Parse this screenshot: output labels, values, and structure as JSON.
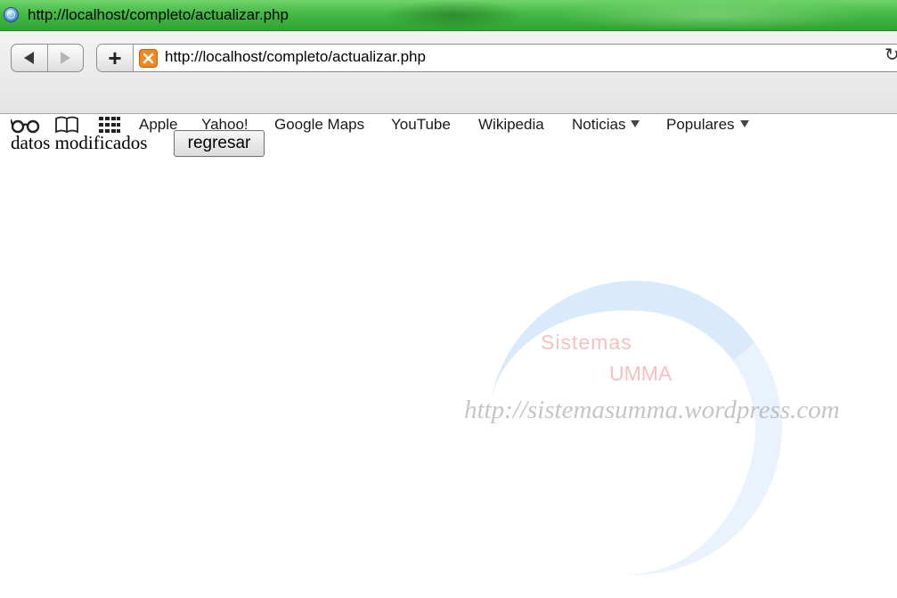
{
  "window": {
    "title": "http://localhost/completo/actualizar.php"
  },
  "toolbar": {
    "url": "http://localhost/completo/actualizar.php",
    "add_label": "+"
  },
  "bookmarks": {
    "items": [
      {
        "label": "Apple"
      },
      {
        "label": "Yahoo!"
      },
      {
        "label": "Google Maps"
      },
      {
        "label": "YouTube"
      },
      {
        "label": "Wikipedia"
      },
      {
        "label": "Noticias"
      },
      {
        "label": "Populares"
      }
    ],
    "icons": [
      "reading-list-icon",
      "bookmarks-book-icon",
      "top-sites-grid-icon"
    ]
  },
  "content": {
    "message": "datos modificados",
    "button_label": "regresar"
  },
  "watermark": {
    "line1": "Sistemas",
    "line2": "UMMA",
    "url": "http://sistemasumma.wordpress.com"
  },
  "colors": {
    "titlebar": "#44b944",
    "site_icon": "#f4861f"
  }
}
